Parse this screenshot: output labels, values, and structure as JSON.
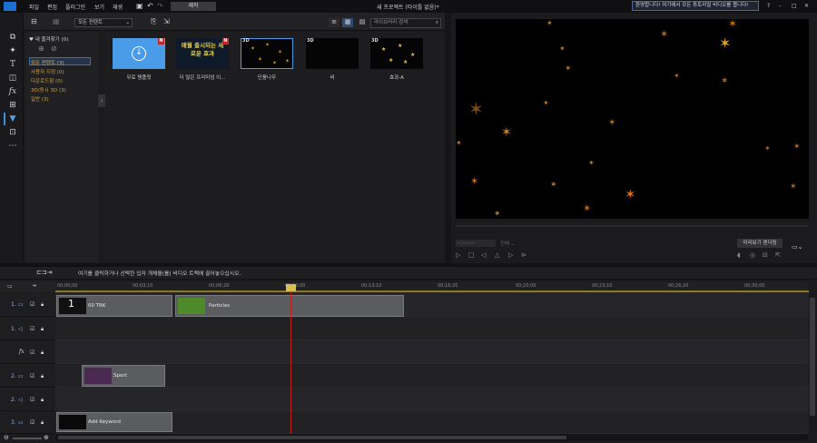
{
  "app": {
    "menu": [
      "파일",
      "편집",
      "플러그인",
      "보기",
      "재생"
    ],
    "produce_label": "제작",
    "project_title": "새 프로젝트 (타이틀 없음)*",
    "welcome_text": "환영합니다! 여기에서 모든 튜토리얼 비디오를 봅니다!",
    "window_controls": [
      "?",
      "-",
      "□",
      "✕"
    ]
  },
  "library": {
    "dropdown_value": "모든 컨텐트",
    "search_placeholder": "라이브러리 검색",
    "favorites_label": "내 즐겨찾기 (0)",
    "categories": [
      "모든 컨텐트 (3)",
      "사용자 지정 (0)",
      "다운로드함 (0)",
      "3D/동시 3D (3)",
      "일반 (3)"
    ],
    "items": [
      {
        "label": "무료 템플릿",
        "badge": "N"
      },
      {
        "label": "더 많은 프리미엄 이...",
        "badge": "N",
        "thumb_text": "매월 출시되는 새로운 효과"
      },
      {
        "label": "단풍나무",
        "badge": "3D"
      },
      {
        "label": "비",
        "badge": "3D"
      },
      {
        "label": "효과-A",
        "badge": "3D"
      }
    ]
  },
  "preview": {
    "timecode": "--;--;--;--",
    "quality": "전체",
    "render_label": "미리보기 렌더링"
  },
  "timeline": {
    "hint": "여기를 클릭하거나 선택한 입자 개체을(를) 비디오 트랙에 끌어놓으십시오.",
    "ruler": [
      "00;00;00",
      "00;03;10",
      "00;06;20",
      "00;10;00",
      "00;13;10",
      "00;16;20",
      "00;20;00",
      "00;23;10",
      "00;26;20",
      "00;30;00"
    ],
    "tracks": [
      "1.",
      "1.",
      "",
      "2.",
      "2.",
      "3."
    ],
    "clips": [
      {
        "label": "00 TRK"
      },
      {
        "label": "Particles"
      },
      {
        "label": "Sport"
      },
      {
        "label": "Add Keyword"
      }
    ]
  }
}
